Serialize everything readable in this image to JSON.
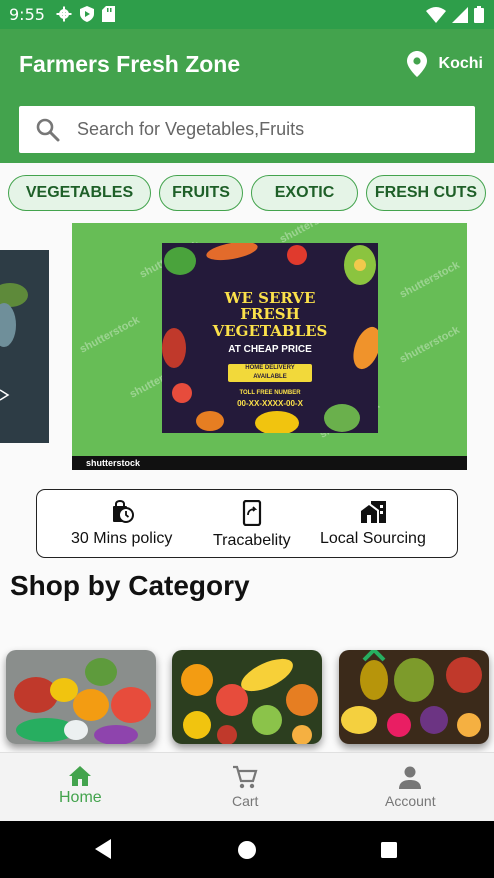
{
  "status_bar": {
    "time": "9:55"
  },
  "header": {
    "title": "Farmers Fresh Zone",
    "location": "Kochi"
  },
  "search": {
    "placeholder": "Search for Vegetables,Fruits"
  },
  "chips": [
    {
      "label": "VEGETABLES"
    },
    {
      "label": "FRUITS"
    },
    {
      "label": "EXOTIC"
    },
    {
      "label": "FRESH CUTS"
    }
  ],
  "banner": {
    "line1": "WE SERVE",
    "line2": "FRESH",
    "line3": "VEGETABLES",
    "line4": "AT CHEAP PRICE",
    "delivery": "HOME DELIVERY AVAILABLE",
    "toll_label": "TOLL FREE NUMBER",
    "toll_number": "00-XX-XXXX-00-X",
    "watermark": "shutterstock"
  },
  "features": [
    {
      "label": "30 Mins policy",
      "icon": "timer-bag-icon"
    },
    {
      "label": "Tracabelity",
      "icon": "phone-share-icon"
    },
    {
      "label": "Local Sourcing",
      "icon": "store-icon"
    }
  ],
  "section": {
    "title": "Shop by Category"
  },
  "bottom_nav": [
    {
      "label": "Home",
      "icon": "home-icon",
      "active": true
    },
    {
      "label": "Cart",
      "icon": "cart-icon",
      "active": false
    },
    {
      "label": "Account",
      "icon": "account-icon",
      "active": false
    }
  ],
  "colors": {
    "primary": "#43a34d",
    "status_bar": "#2e9e4a",
    "chip_bg": "#e5f4e7",
    "chip_text": "#1e5f28"
  }
}
